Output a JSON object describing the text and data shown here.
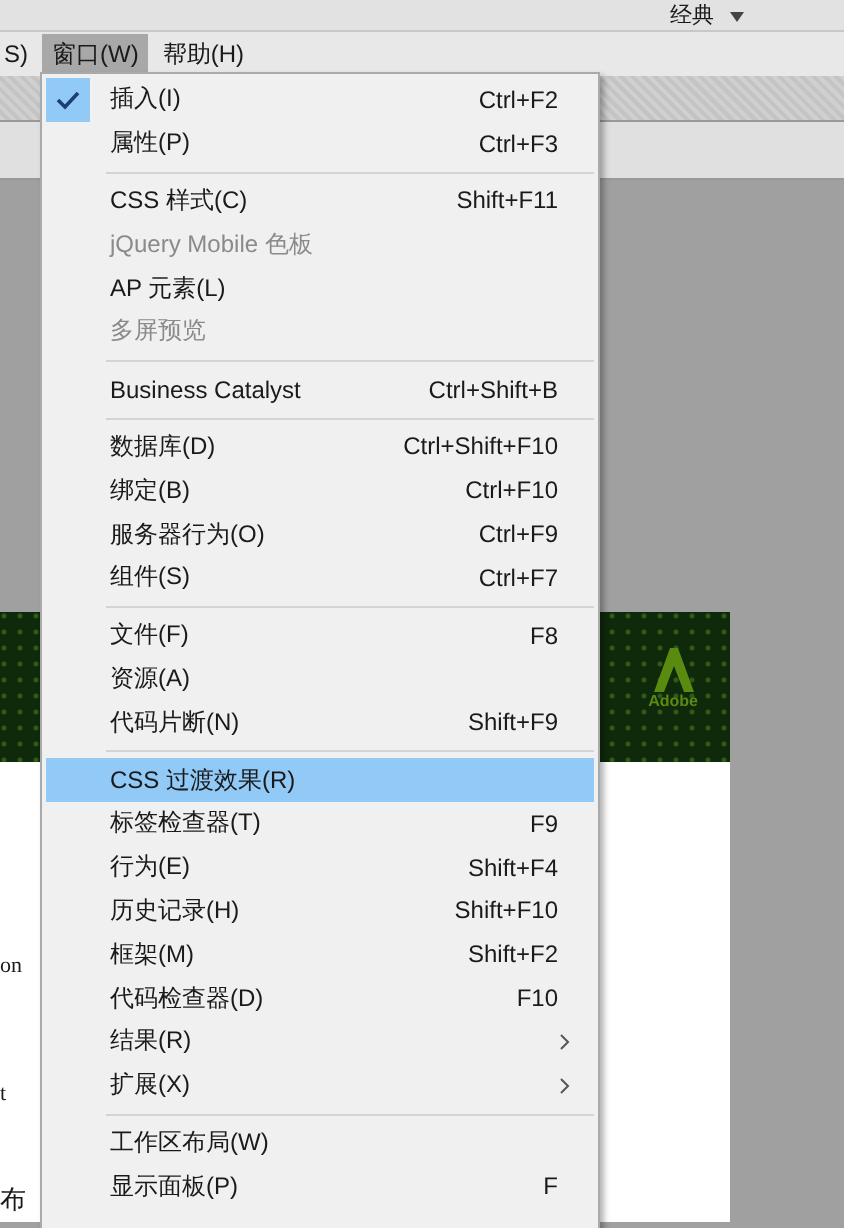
{
  "workspace_switcher": {
    "label": "经典"
  },
  "menubar": [
    {
      "label": "S)",
      "selected": false
    },
    {
      "label": "窗口(W)",
      "selected": true
    },
    {
      "label": "帮助(H)",
      "selected": false
    }
  ],
  "banner": {
    "logo_text": "Adobe"
  },
  "document_fragments": [
    "on",
    "t",
    "布"
  ],
  "menu": {
    "groups": [
      [
        {
          "label": "插入(I)",
          "shortcut": "Ctrl+F2",
          "checked": true,
          "disabled": false,
          "selected": false,
          "submenu": false
        },
        {
          "label": "属性(P)",
          "shortcut": "Ctrl+F3",
          "checked": false,
          "disabled": false,
          "selected": false,
          "submenu": false
        }
      ],
      [
        {
          "label": "CSS 样式(C)",
          "shortcut": "Shift+F11",
          "checked": false,
          "disabled": false,
          "selected": false,
          "submenu": false
        },
        {
          "label": "jQuery Mobile 色板",
          "checked": false,
          "disabled": true,
          "selected": false,
          "submenu": false
        },
        {
          "label": "AP 元素(L)",
          "checked": false,
          "disabled": false,
          "selected": false,
          "submenu": false
        },
        {
          "label": "多屏预览",
          "checked": false,
          "disabled": true,
          "selected": false,
          "submenu": false
        }
      ],
      [
        {
          "label": "Business Catalyst",
          "shortcut": "Ctrl+Shift+B",
          "checked": false,
          "disabled": false,
          "selected": false,
          "submenu": false
        }
      ],
      [
        {
          "label": "数据库(D)",
          "shortcut": "Ctrl+Shift+F10",
          "checked": false,
          "disabled": false,
          "selected": false,
          "submenu": false
        },
        {
          "label": "绑定(B)",
          "shortcut": "Ctrl+F10",
          "checked": false,
          "disabled": false,
          "selected": false,
          "submenu": false
        },
        {
          "label": "服务器行为(O)",
          "shortcut": "Ctrl+F9",
          "checked": false,
          "disabled": false,
          "selected": false,
          "submenu": false
        },
        {
          "label": "组件(S)",
          "shortcut": "Ctrl+F7",
          "checked": false,
          "disabled": false,
          "selected": false,
          "submenu": false
        }
      ],
      [
        {
          "label": "文件(F)",
          "shortcut": "F8",
          "checked": false,
          "disabled": false,
          "selected": false,
          "submenu": false
        },
        {
          "label": "资源(A)",
          "checked": false,
          "disabled": false,
          "selected": false,
          "submenu": false
        },
        {
          "label": "代码片断(N)",
          "shortcut": "Shift+F9",
          "checked": false,
          "disabled": false,
          "selected": false,
          "submenu": false
        }
      ],
      [
        {
          "label": "CSS 过渡效果(R)",
          "checked": false,
          "disabled": false,
          "selected": true,
          "submenu": false
        },
        {
          "label": "标签检查器(T)",
          "shortcut": "F9",
          "checked": false,
          "disabled": false,
          "selected": false,
          "submenu": false
        },
        {
          "label": "行为(E)",
          "shortcut": "Shift+F4",
          "checked": false,
          "disabled": false,
          "selected": false,
          "submenu": false
        },
        {
          "label": "历史记录(H)",
          "shortcut": "Shift+F10",
          "checked": false,
          "disabled": false,
          "selected": false,
          "submenu": false
        },
        {
          "label": "框架(M)",
          "shortcut": "Shift+F2",
          "checked": false,
          "disabled": false,
          "selected": false,
          "submenu": false
        },
        {
          "label": "代码检查器(D)",
          "shortcut": "F10",
          "checked": false,
          "disabled": false,
          "selected": false,
          "submenu": false
        },
        {
          "label": "结果(R)",
          "checked": false,
          "disabled": false,
          "selected": false,
          "submenu": true
        },
        {
          "label": "扩展(X)",
          "checked": false,
          "disabled": false,
          "selected": false,
          "submenu": true
        }
      ],
      [
        {
          "label": "工作区布局(W)",
          "checked": false,
          "disabled": false,
          "selected": false,
          "submenu": false
        },
        {
          "label": "显示面板(P)",
          "shortcut": "F",
          "checked": false,
          "disabled": false,
          "selected": false,
          "submenu": false
        }
      ]
    ]
  }
}
